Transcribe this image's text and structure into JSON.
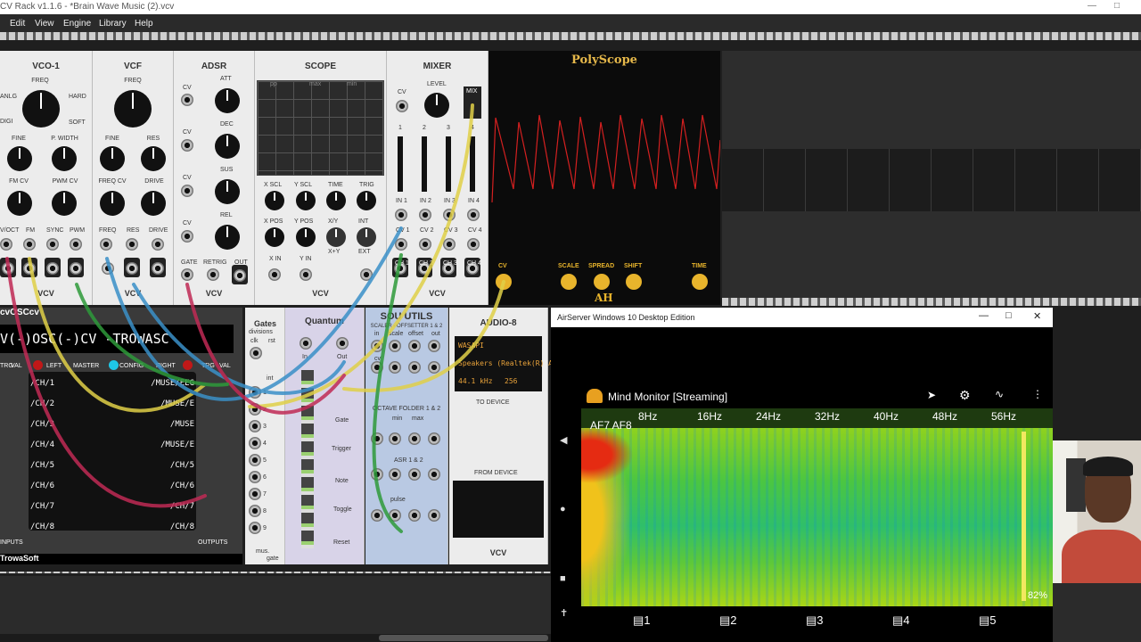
{
  "window": {
    "title": "CV Rack v1.1.6 - *Brain Wave Music (2).vcv"
  },
  "menu": [
    "Edit",
    "View",
    "Engine",
    "Library",
    "Help"
  ],
  "modules": {
    "vco": {
      "title": "VCO-1",
      "freq": "FREQ",
      "anlg": "ANLG",
      "digi": "DIGI",
      "hard": "HARD",
      "soft": "SOFT",
      "fine": "FINE",
      "pwidth": "P. WIDTH",
      "fmcv": "FM CV",
      "pwmcv": "PWM CV",
      "ins": [
        "V/OCT",
        "FM",
        "SYNC",
        "PWM"
      ],
      "outs": [
        "SIN",
        "TRI",
        "SAW",
        "SQR"
      ]
    },
    "vcf": {
      "title": "VCF",
      "freq": "FREQ",
      "fine": "FINE",
      "res": "RES",
      "freqcv": "FREQ CV",
      "drive": "DRIVE",
      "ins": [
        "FREQ",
        "RES",
        "DRIVE"
      ],
      "outs": [
        "IN",
        "LPF",
        "HPF"
      ]
    },
    "adsr": {
      "title": "ADSR",
      "att": "ATT",
      "dec": "DEC",
      "sus": "SUS",
      "rel": "REL",
      "cv": "CV",
      "gate": "GATE",
      "retrig": "RETRIG",
      "out": "OUT"
    },
    "scope": {
      "title": "SCOPE",
      "xscl": "X SCL",
      "yscl": "Y SCL",
      "time": "TIME",
      "trig": "TRIG",
      "xpos": "X POS",
      "ypos": "Y POS",
      "xy": "X/Y",
      "xpy": "X+Y",
      "int": "INT",
      "ext": "EXT",
      "xin": "X IN",
      "yin": "Y IN",
      "pp": "pp",
      "max": "max",
      "min": "min"
    },
    "mixer": {
      "title": "MIXER",
      "level": "LEVEL",
      "mix": "MIX",
      "cv": "CV",
      "channels": [
        "1",
        "2",
        "3",
        "4"
      ],
      "ins": [
        "IN 1",
        "IN 2",
        "IN 3",
        "IN 4"
      ],
      "cvs": [
        "CV 1",
        "CV 2",
        "CV 3",
        "CV 4"
      ],
      "outs": [
        "CH 1",
        "CH 2",
        "CH 3",
        "CH 4"
      ]
    },
    "brand": "VCV"
  },
  "polyscope": {
    "title": "PolyScope",
    "scale": "SCALE",
    "spread": "SPREAD",
    "shift": "SHIFT",
    "time": "TIME",
    "cv": "CV",
    "logo": "AH",
    "color": "#d42020"
  },
  "lower": {
    "osc": {
      "title": "cvOSCcv",
      "display": "V(-)OSC(-)CV -TROWASC",
      "trg": "TRG",
      "val": "VAL",
      "left": "LEFT",
      "master": "MASTER",
      "config": "CONFIG",
      "right": "RIGHT",
      "outputs": "OUTPUTS",
      "inputs": "INPUTS",
      "brand": "TrowaSoft",
      "left_ch": [
        "/CH/1",
        "/CH/2",
        "/CH/3",
        "/CH/4",
        "/CH/5",
        "/CH/6",
        "/CH/7",
        "/CH/8"
      ],
      "right_ch": [
        "/MUSE/EEG",
        "/MUSE/E",
        "/MUSE",
        "/MUSE/E",
        "/CH/5",
        "/CH/6",
        "/CH/7",
        "/CH/8"
      ]
    },
    "gates": {
      "title": "Gates",
      "sub": "divisions",
      "clk": "clk",
      "rst": "rst",
      "int": "int",
      "nums": [
        "1",
        "2",
        "3",
        "4",
        "5",
        "6",
        "7",
        "8",
        "9"
      ],
      "mus": "mus.",
      "gate": "gate"
    },
    "quantum": {
      "title": "Quantum",
      "in": "In",
      "out": "Out",
      "gate": "Gate",
      "trigger": "Trigger",
      "note": "Note",
      "toggle": "Toggle",
      "reset": "Reset"
    },
    "sou": {
      "title": "SOU UTILS",
      "sub": "SCALER - OFFSETTER 1 & 2",
      "scale": "scale",
      "offset": "offset",
      "in": "in",
      "cv": "cv",
      "out": "out",
      "octave": "OCTAVE FOLDER 1 & 2",
      "min": "min",
      "max": "max",
      "asr": "ASR 1 & 2",
      "pulse": "pulse"
    },
    "audio": {
      "title": "AUDIO-8",
      "driver": "WASAPI",
      "device": "Speakers (Realtek(R) A",
      "rate": "44.1 kHz",
      "block": "256",
      "to": "TO DEVICE",
      "from": "FROM DEVICE",
      "brand": "VCV",
      "nums": [
        "1",
        "2",
        "3",
        "4",
        "5",
        "6",
        "7",
        "8"
      ]
    }
  },
  "airserver": {
    "title": "AirServer Windows 10 Desktop Edition"
  },
  "mindmonitor": {
    "title": "Mind Monitor [Streaming]",
    "freqs": [
      "8Hz",
      "16Hz",
      "24Hz",
      "32Hz",
      "40Hz",
      "48Hz",
      "56Hz"
    ],
    "channels": "AF7 AF8",
    "percent": "82%",
    "tabs": [
      "1",
      "2",
      "3",
      "4",
      "5"
    ]
  }
}
